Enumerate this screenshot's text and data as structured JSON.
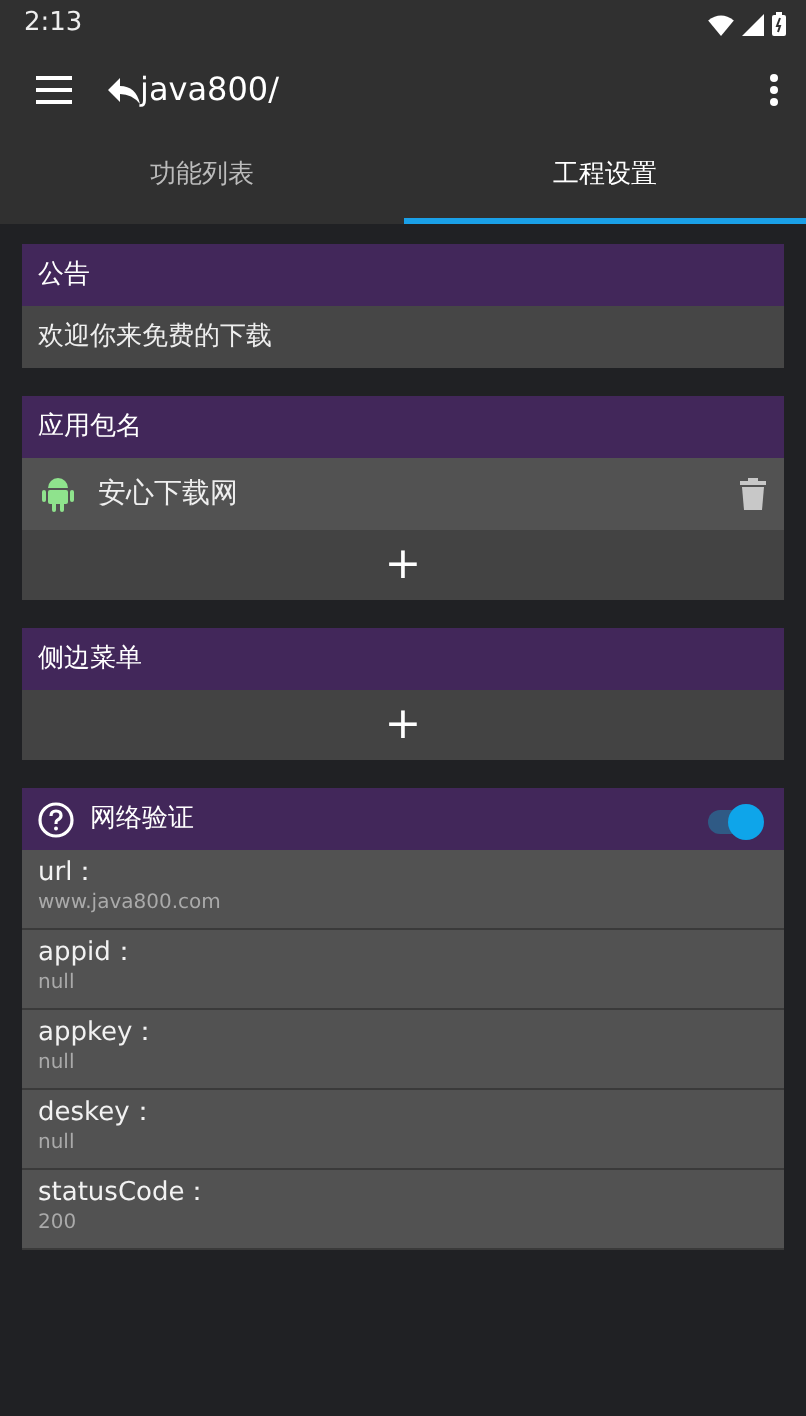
{
  "status_bar": {
    "time": "2:13"
  },
  "app_bar": {
    "path": "java800/"
  },
  "tabs": [
    {
      "label": "功能列表",
      "selected": false
    },
    {
      "label": "工程设置",
      "selected": true
    }
  ],
  "sections": [
    {
      "kind": "text",
      "title": "公告",
      "text": "欢迎你来免费的下载"
    },
    {
      "kind": "list",
      "title": "应用包名",
      "items": [
        {
          "label": "安心下载网"
        }
      ],
      "add": "+"
    },
    {
      "kind": "list",
      "title": "侧边菜单",
      "add": "+"
    },
    {
      "kind": "fields",
      "title": "网络验证",
      "on": true,
      "fields": [
        {
          "label": "url：",
          "value": "www.java800.com"
        },
        {
          "label": "appid：",
          "value": "null"
        },
        {
          "label": "appkey：",
          "value": "null"
        },
        {
          "label": "deskey：",
          "value": "null"
        },
        {
          "label": "statusCode：",
          "value": "200"
        }
      ]
    }
  ]
}
